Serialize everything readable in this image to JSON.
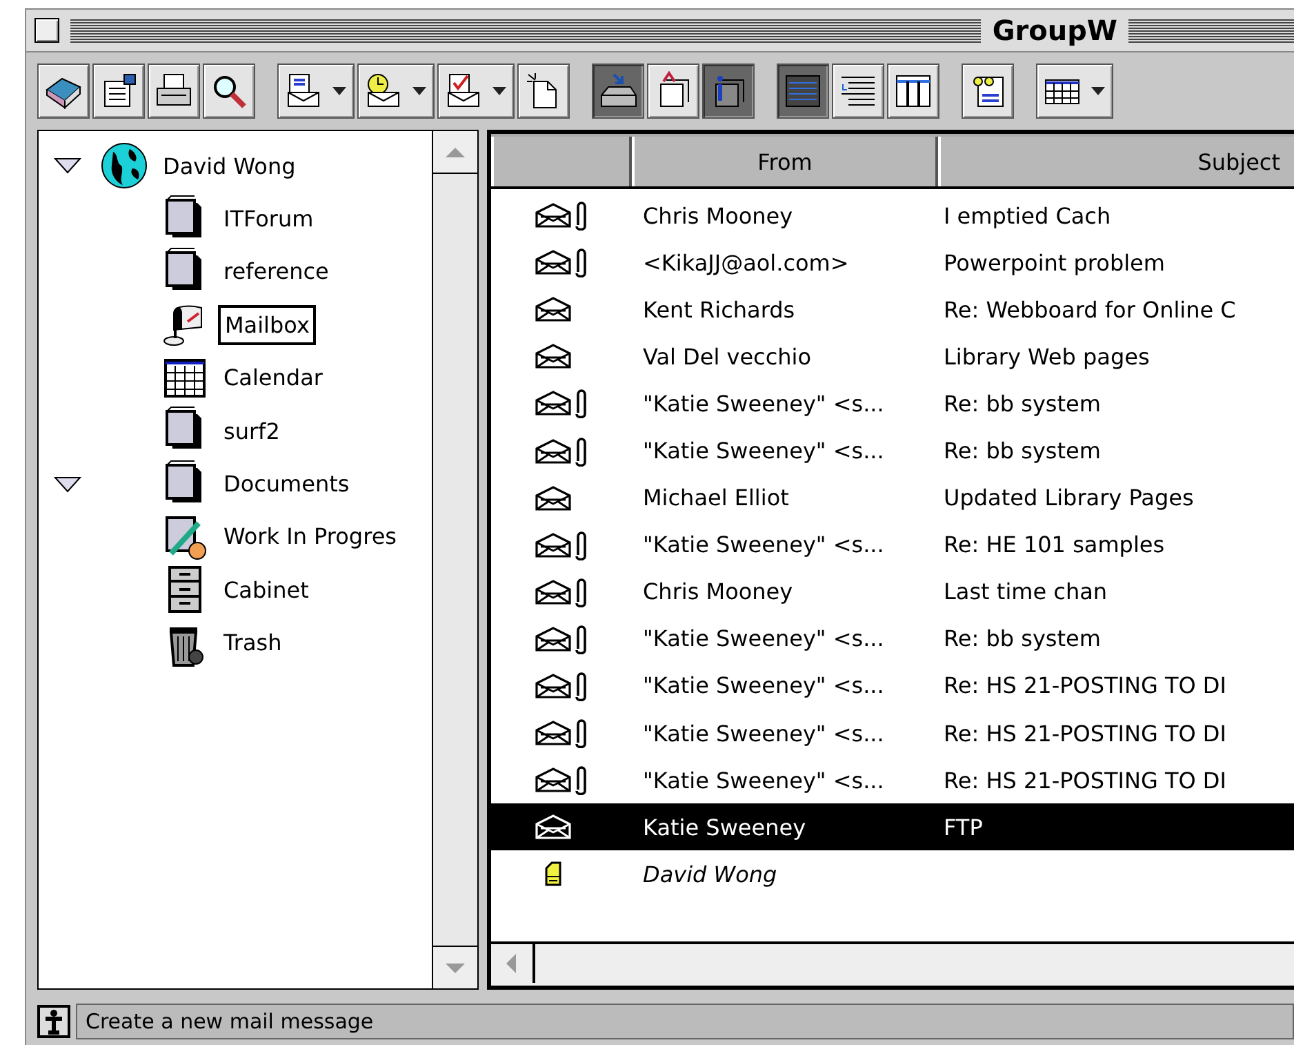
{
  "window": {
    "title": "GroupW"
  },
  "toolbar": {
    "groups": [
      [
        {
          "pressed": false,
          "menu": false
        },
        {
          "pressed": false,
          "menu": false
        },
        {
          "pressed": false,
          "menu": false
        },
        {
          "pressed": false,
          "menu": false
        }
      ],
      [
        {
          "pressed": false,
          "menu": true
        },
        {
          "pressed": false,
          "menu": true
        },
        {
          "pressed": false,
          "menu": true
        },
        {
          "pressed": false,
          "menu": false
        }
      ],
      [
        {
          "pressed": true,
          "menu": false
        },
        {
          "pressed": false,
          "menu": false
        },
        {
          "pressed": true,
          "menu": false
        }
      ],
      [
        {
          "pressed": true,
          "menu": false
        },
        {
          "pressed": false,
          "menu": false
        },
        {
          "pressed": false,
          "menu": false
        }
      ],
      [
        {
          "pressed": false,
          "menu": false
        }
      ],
      [
        {
          "pressed": false,
          "menu": true
        }
      ]
    ]
  },
  "folders": [
    {
      "label": "David Wong",
      "kind": "user",
      "expanded": true,
      "selected": false,
      "children": [
        {
          "label": "ITForum",
          "kind": "folder",
          "selected": false
        },
        {
          "label": "reference",
          "kind": "folder",
          "selected": false
        },
        {
          "label": "Mailbox",
          "kind": "mailbox",
          "selected": true
        },
        {
          "label": "Calendar",
          "kind": "calendar",
          "selected": false
        },
        {
          "label": "surf2",
          "kind": "folder",
          "selected": false
        },
        {
          "label": "Documents",
          "kind": "folder",
          "expanded": true,
          "selected": false
        },
        {
          "label": "Work In Progres",
          "kind": "work",
          "selected": false
        },
        {
          "label": "Cabinet",
          "kind": "cabinet",
          "selected": false
        },
        {
          "label": "Trash",
          "kind": "trash",
          "selected": false
        }
      ]
    }
  ],
  "messages": {
    "columns": [
      "From",
      "Subject"
    ],
    "rows": [
      {
        "kind": "mail",
        "attachment": true,
        "from": "Chris Mooney",
        "subject": "I emptied Cach",
        "selected": false
      },
      {
        "kind": "mail",
        "attachment": true,
        "from": "<KikaJJ@aol.com>",
        "subject": "Powerpoint problem",
        "selected": false
      },
      {
        "kind": "mail",
        "attachment": false,
        "from": "Kent Richards",
        "subject": "Re: Webboard for Online C",
        "selected": false
      },
      {
        "kind": "mail",
        "attachment": false,
        "from": "Val Del vecchio",
        "subject": "Library Web pages",
        "selected": false
      },
      {
        "kind": "mail",
        "attachment": true,
        "from": "\"Katie Sweeney\" <s...",
        "subject": "Re: bb system",
        "selected": false
      },
      {
        "kind": "mail",
        "attachment": true,
        "from": "\"Katie Sweeney\" <s...",
        "subject": "Re: bb system",
        "selected": false
      },
      {
        "kind": "mail",
        "attachment": false,
        "from": "Michael Elliot",
        "subject": "Updated Library Pages",
        "selected": false
      },
      {
        "kind": "mail",
        "attachment": true,
        "from": "\"Katie Sweeney\" <s...",
        "subject": "Re: HE 101 samples",
        "selected": false
      },
      {
        "kind": "mail",
        "attachment": true,
        "from": "Chris Mooney",
        "subject": "Last time chan",
        "selected": false
      },
      {
        "kind": "mail",
        "attachment": true,
        "from": "\"Katie Sweeney\" <s...",
        "subject": "Re: bb system",
        "selected": false
      },
      {
        "kind": "mail",
        "attachment": true,
        "from": "\"Katie Sweeney\" <s...",
        "subject": "Re: HS 21-POSTING TO DI",
        "selected": false
      },
      {
        "kind": "mail",
        "attachment": true,
        "from": "\"Katie Sweeney\" <s...",
        "subject": "Re: HS 21-POSTING TO DI",
        "selected": false
      },
      {
        "kind": "mail",
        "attachment": true,
        "from": "\"Katie Sweeney\" <s...",
        "subject": "Re: HS 21-POSTING TO DI",
        "selected": false
      },
      {
        "kind": "mail",
        "attachment": false,
        "from": "Katie Sweeney",
        "subject": "FTP",
        "selected": true
      },
      {
        "kind": "draft",
        "attachment": false,
        "from": "David Wong",
        "selected": false
      }
    ]
  },
  "status_bar": {
    "text": "Create a new mail message"
  }
}
